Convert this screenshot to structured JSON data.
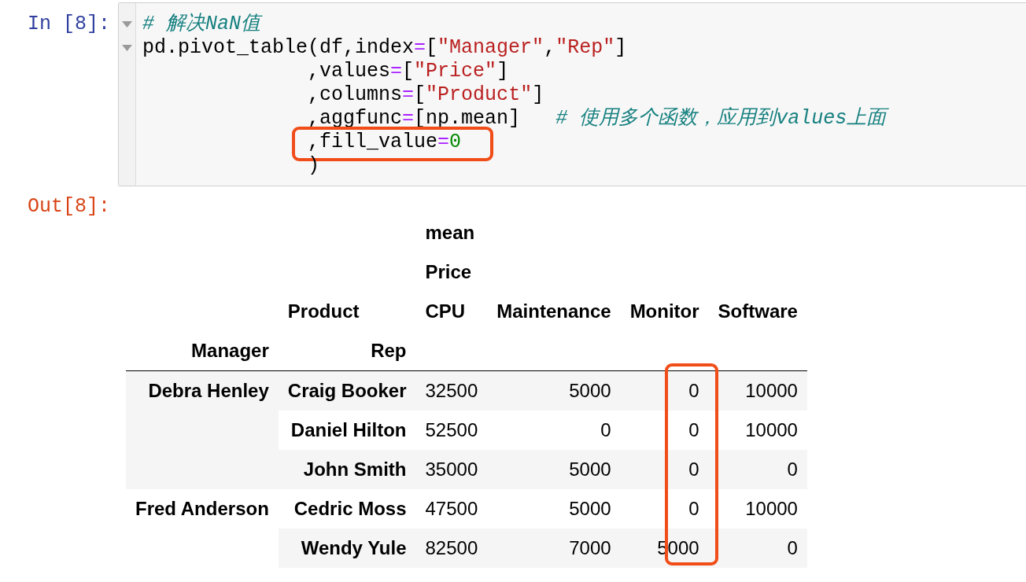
{
  "input_cell": {
    "prompt": "In [8]:",
    "lines": [
      {
        "fold_marker": true,
        "highlighted": false,
        "tokens": [
          {
            "kind": "comment",
            "text": "# 解决NaN值"
          }
        ]
      },
      {
        "fold_marker": true,
        "highlighted": false,
        "tokens": [
          {
            "kind": "plain",
            "text": "pd.pivot_table(df,index"
          },
          {
            "kind": "operator",
            "text": "="
          },
          {
            "kind": "plain",
            "text": "["
          },
          {
            "kind": "string",
            "text": "\"Manager\""
          },
          {
            "kind": "plain",
            "text": ","
          },
          {
            "kind": "string",
            "text": "\"Rep\""
          },
          {
            "kind": "plain",
            "text": "]"
          }
        ]
      },
      {
        "fold_marker": false,
        "highlighted": false,
        "tokens": [
          {
            "kind": "plain",
            "text": "              ,values"
          },
          {
            "kind": "operator",
            "text": "="
          },
          {
            "kind": "plain",
            "text": "["
          },
          {
            "kind": "string",
            "text": "\"Price\""
          },
          {
            "kind": "plain",
            "text": "]"
          }
        ]
      },
      {
        "fold_marker": false,
        "highlighted": false,
        "tokens": [
          {
            "kind": "plain",
            "text": "              ,columns"
          },
          {
            "kind": "operator",
            "text": "="
          },
          {
            "kind": "plain",
            "text": "["
          },
          {
            "kind": "string",
            "text": "\"Product\""
          },
          {
            "kind": "plain",
            "text": "]"
          }
        ]
      },
      {
        "fold_marker": false,
        "highlighted": false,
        "tokens": [
          {
            "kind": "plain",
            "text": "              ,aggfunc"
          },
          {
            "kind": "operator",
            "text": "="
          },
          {
            "kind": "plain",
            "text": "[np.mean]   "
          },
          {
            "kind": "comment",
            "text": "# 使用多个函数，应用到values上面"
          }
        ]
      },
      {
        "fold_marker": false,
        "highlighted": true,
        "tokens": [
          {
            "kind": "plain",
            "text": "              ,fill_value"
          },
          {
            "kind": "operator",
            "text": "="
          },
          {
            "kind": "number",
            "text": "0"
          }
        ]
      },
      {
        "fold_marker": false,
        "highlighted": false,
        "tokens": [
          {
            "kind": "plain",
            "text": "              )"
          }
        ]
      }
    ]
  },
  "output_cell": {
    "prompt": "Out[8]:",
    "table": {
      "column_levels": [
        "mean",
        "Price"
      ],
      "columns_name": "Product",
      "columns": [
        {
          "label": "CPU",
          "highlighted": false
        },
        {
          "label": "Maintenance",
          "highlighted": false
        },
        {
          "label": "Monitor",
          "highlighted": true
        },
        {
          "label": "Software",
          "highlighted": false
        }
      ],
      "index_names": [
        "Manager",
        "Rep"
      ],
      "groups": [
        {
          "manager": "Debra Henley",
          "rows": [
            {
              "rep": "Craig Booker",
              "values": [
                "32500",
                "5000",
                "0",
                "10000"
              ]
            },
            {
              "rep": "Daniel Hilton",
              "values": [
                "52500",
                "0",
                "0",
                "10000"
              ]
            },
            {
              "rep": "John Smith",
              "values": [
                "35000",
                "5000",
                "0",
                "0"
              ]
            }
          ]
        },
        {
          "manager": "Fred Anderson",
          "rows": [
            {
              "rep": "Cedric Moss",
              "values": [
                "47500",
                "5000",
                "0",
                "10000"
              ]
            },
            {
              "rep": "Wendy Yule",
              "values": [
                "82500",
                "7000",
                "5000",
                "0"
              ]
            }
          ]
        }
      ]
    }
  }
}
